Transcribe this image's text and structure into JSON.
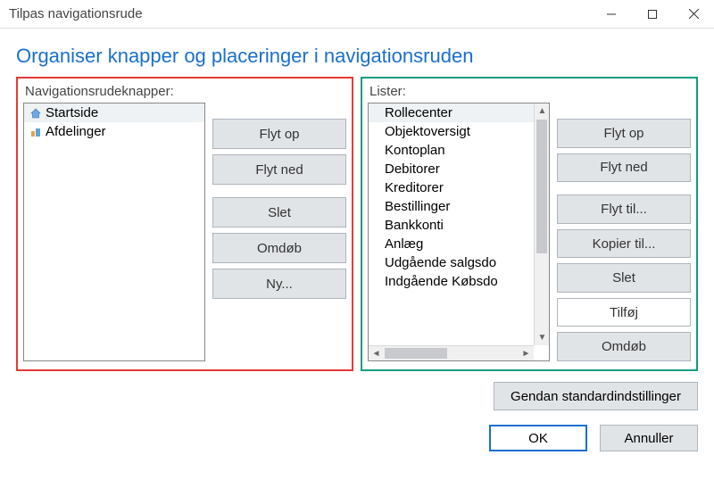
{
  "window": {
    "title": "Tilpas navigationsrude"
  },
  "heading": "Organiser knapper og placeringer i navigationsruden",
  "left": {
    "label": "Navigationsrudeknapper:",
    "items": [
      {
        "icon": "home-icon",
        "label": "Startside",
        "selected": true
      },
      {
        "icon": "dept-icon",
        "label": "Afdelinger",
        "selected": false
      }
    ],
    "buttons": {
      "move_up": "Flyt op",
      "move_down": "Flyt ned",
      "delete": "Slet",
      "rename": "Omdøb",
      "new": "Ny..."
    }
  },
  "right": {
    "label": "Lister:",
    "items": [
      {
        "label": "Rollecenter",
        "selected": true
      },
      {
        "label": "Objektoversigt"
      },
      {
        "label": "Kontoplan"
      },
      {
        "label": "Debitorer"
      },
      {
        "label": "Kreditorer"
      },
      {
        "label": "Bestillinger"
      },
      {
        "label": "Bankkonti"
      },
      {
        "label": "Anlæg"
      },
      {
        "label": "Udgående salgsdo"
      },
      {
        "label": "Indgående Købsdo"
      }
    ],
    "buttons": {
      "move_up": "Flyt op",
      "move_down": "Flyt ned",
      "move_to": "Flyt til...",
      "copy_to": "Kopier til...",
      "delete": "Slet",
      "add": "Tilføj",
      "rename": "Omdøb"
    }
  },
  "footer": {
    "restore_defaults": "Gendan standardindstillinger",
    "ok": "OK",
    "cancel": "Annuller"
  }
}
